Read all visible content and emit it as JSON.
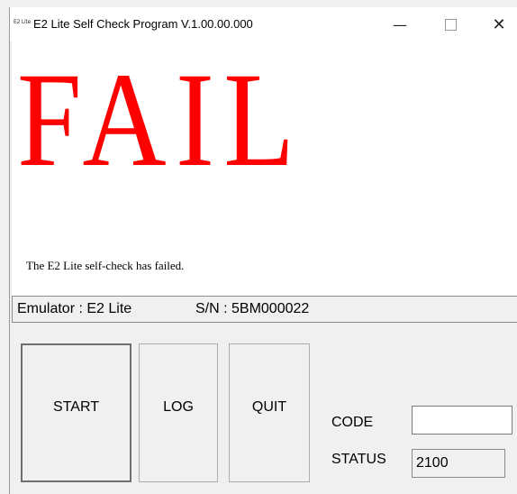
{
  "window": {
    "icon_text": "E2 Lite",
    "title": "E2 Lite Self Check Program V.1.00.00.000",
    "controls": {
      "minimize": "—",
      "close": "✕"
    }
  },
  "result": {
    "headline": "FAIL",
    "headline_color": "#ff0000",
    "message": "The E2 Lite self-check has failed."
  },
  "info": {
    "emulator": "Emulator : E2 Lite",
    "serial": "S/N : 5BM000022"
  },
  "buttons": {
    "start": "START",
    "log": "LOG",
    "quit": "QUIT"
  },
  "fields": {
    "code_label": "CODE",
    "code_value": "",
    "status_label": "STATUS",
    "status_value": "2100"
  }
}
